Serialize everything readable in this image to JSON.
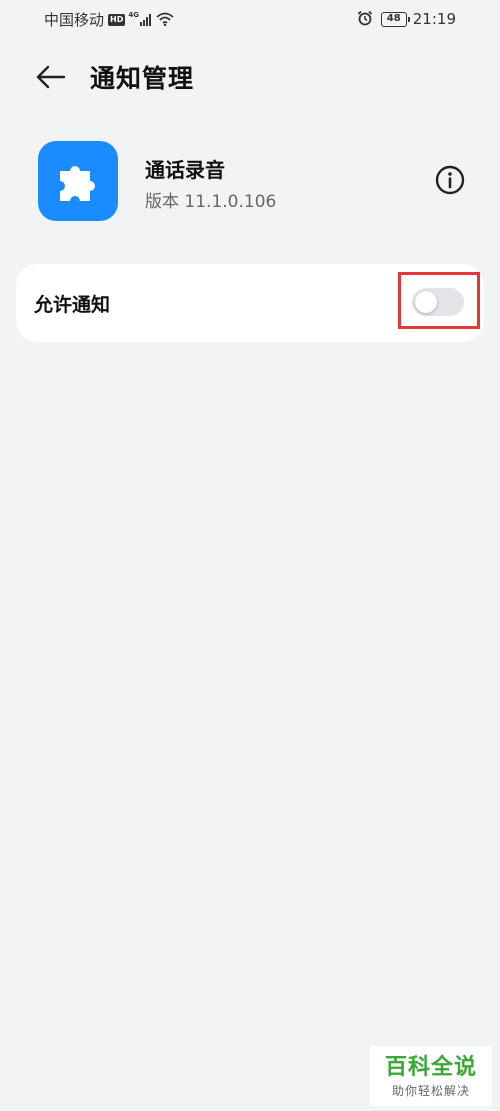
{
  "status_bar": {
    "carrier": "中国移动",
    "hd_badge": "HD",
    "network_type": "4G",
    "battery_level": "48",
    "time": "21:19",
    "icons": [
      "hd-icon",
      "signal-icon",
      "wifi-icon",
      "alarm-icon",
      "battery-icon"
    ]
  },
  "header": {
    "back_icon": "arrow-left-icon",
    "title": "通知管理"
  },
  "app": {
    "icon": "puzzle-piece-icon",
    "icon_bg_color": "#1a8cff",
    "name": "通话录音",
    "version": "版本 11.1.0.106",
    "info_icon": "info-circle-icon"
  },
  "settings": {
    "allow_notifications_label": "允许通知",
    "allow_notifications_enabled": false,
    "highlight_color": "#e5373a"
  },
  "watermark": {
    "title": "百科全说",
    "subtitle": "助你轻松解决",
    "color": "#3aa835"
  }
}
